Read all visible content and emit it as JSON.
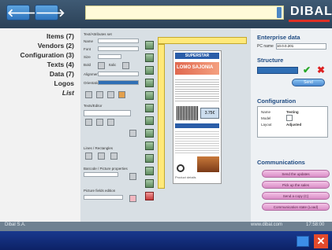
{
  "header": {
    "back_label": "🡐",
    "forward_label": "🡒",
    "address_value": "",
    "brand": "DIBAL"
  },
  "leftnav": {
    "items": [
      "Items (7)",
      "Vendors (2)",
      "Configuration (3)",
      "Texts (4)",
      "Data (7)",
      "Logos",
      "List"
    ]
  },
  "center": {
    "top_label": "Text/Attributes set",
    "fields": [
      "Name",
      "Font",
      "Size",
      "Bold",
      "Italic",
      "Alignment",
      "Orientation"
    ],
    "mid_label": "Texts/Editor",
    "grp1": "Lines / Rectangles",
    "grp2": "Barcode / Picture properties",
    "grp3": "Picture fields edition"
  },
  "label": {
    "banner": "SUPERSTAR",
    "product": "LOMO SAJONIA",
    "price": "3.75€",
    "footer_text": "Product details"
  },
  "right": {
    "enterprise_title": "Enterprise data",
    "pc_name_label": "PC name",
    "pc_name_value": "10.0.0.201",
    "structure_title": "Structure",
    "structure_value": "",
    "send_label": "Send",
    "config_title": "Configuration",
    "config_rows": [
      {
        "k": "Name",
        "v": "Testing"
      },
      {
        "k": "Model",
        "v": ""
      },
      {
        "k": "Layout",
        "v": "Adjusted"
      }
    ],
    "comm_title": "Communications",
    "comm_buttons": [
      "Send the updates",
      "Pick up the sales",
      "Send a copy (C)",
      "Communication state (Load)"
    ]
  },
  "footer": {
    "company": "Dibal S.A.",
    "website": "www.dibal.com",
    "time": "17:58:00"
  },
  "colors": {
    "accent": "#2f74bd",
    "brand_red": "#e03024",
    "pink": "#d98bc6"
  }
}
